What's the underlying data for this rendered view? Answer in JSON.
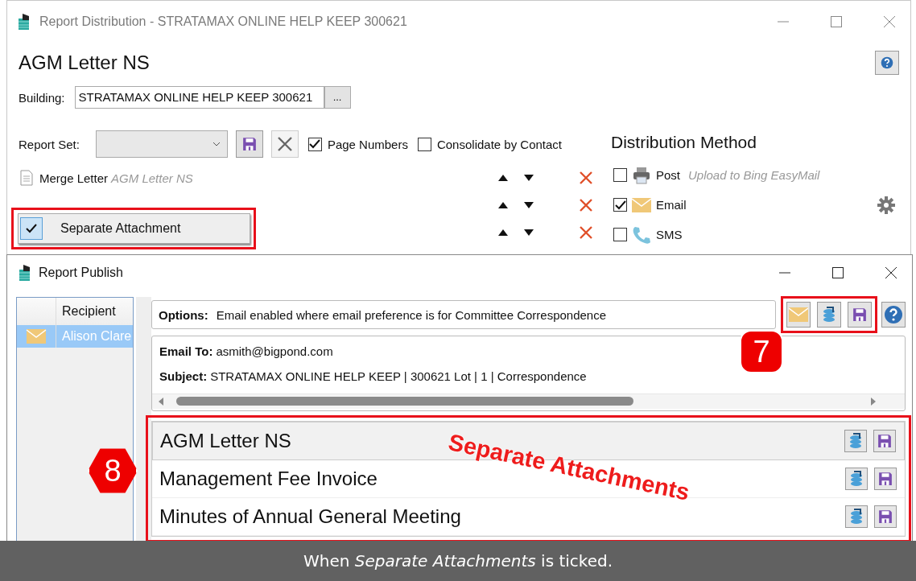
{
  "distribution_window": {
    "title": "Report Distribution - STRATAMAX ONLINE HELP KEEP 300621",
    "heading": "AGM Letter NS",
    "building_label": "Building:",
    "building_value": "STRATAMAX ONLINE HELP KEEP 300621",
    "browse_button": "...",
    "report_set_label": "Report Set:",
    "options": [
      {
        "label": "Page Numbers",
        "checked": true
      },
      {
        "label": "Consolidate by Contact",
        "checked": false
      }
    ],
    "reports": [
      {
        "kind": "letter",
        "name": "Merge Letter",
        "detail": "AGM Letter NS"
      },
      {
        "kind": "covered"
      },
      {
        "kind": "covered"
      }
    ],
    "distribution_heading": "Distribution Method",
    "methods": [
      {
        "kind": "post",
        "label": "Post",
        "note": "Upload to Bing EasyMail",
        "checked": false
      },
      {
        "kind": "email",
        "label": "Email",
        "checked": true
      },
      {
        "kind": "sms",
        "label": "SMS",
        "checked": false
      }
    ]
  },
  "context_menu": {
    "items": [
      {
        "label": "Separate Attachment",
        "checked": true
      }
    ]
  },
  "publish_window": {
    "title": "Report Publish",
    "recipient_column": "Recipient",
    "recipients": [
      {
        "name": "Alison Clare",
        "selected": true
      }
    ],
    "options_label": "Options:",
    "options_text": "Email enabled where email preference is for Committee Correspondence",
    "email_to_label": "Email To:",
    "email_to": "asmith@bigpond.com",
    "subject_label": "Subject:",
    "subject": "STRATAMAX ONLINE HELP KEEP | 300621 Lot | 1 | Correspondence",
    "attachments": [
      {
        "name": "AGM Letter NS",
        "selected": true
      },
      {
        "name": "Management Fee Invoice",
        "selected": false
      },
      {
        "name": "Minutes of Annual General Meeting",
        "selected": false
      }
    ]
  },
  "callouts": [
    {
      "number": "7"
    },
    {
      "number": "8"
    }
  ],
  "annotation": "Separate Attachments",
  "caption": "When *Separate Attachments* is ticked."
}
